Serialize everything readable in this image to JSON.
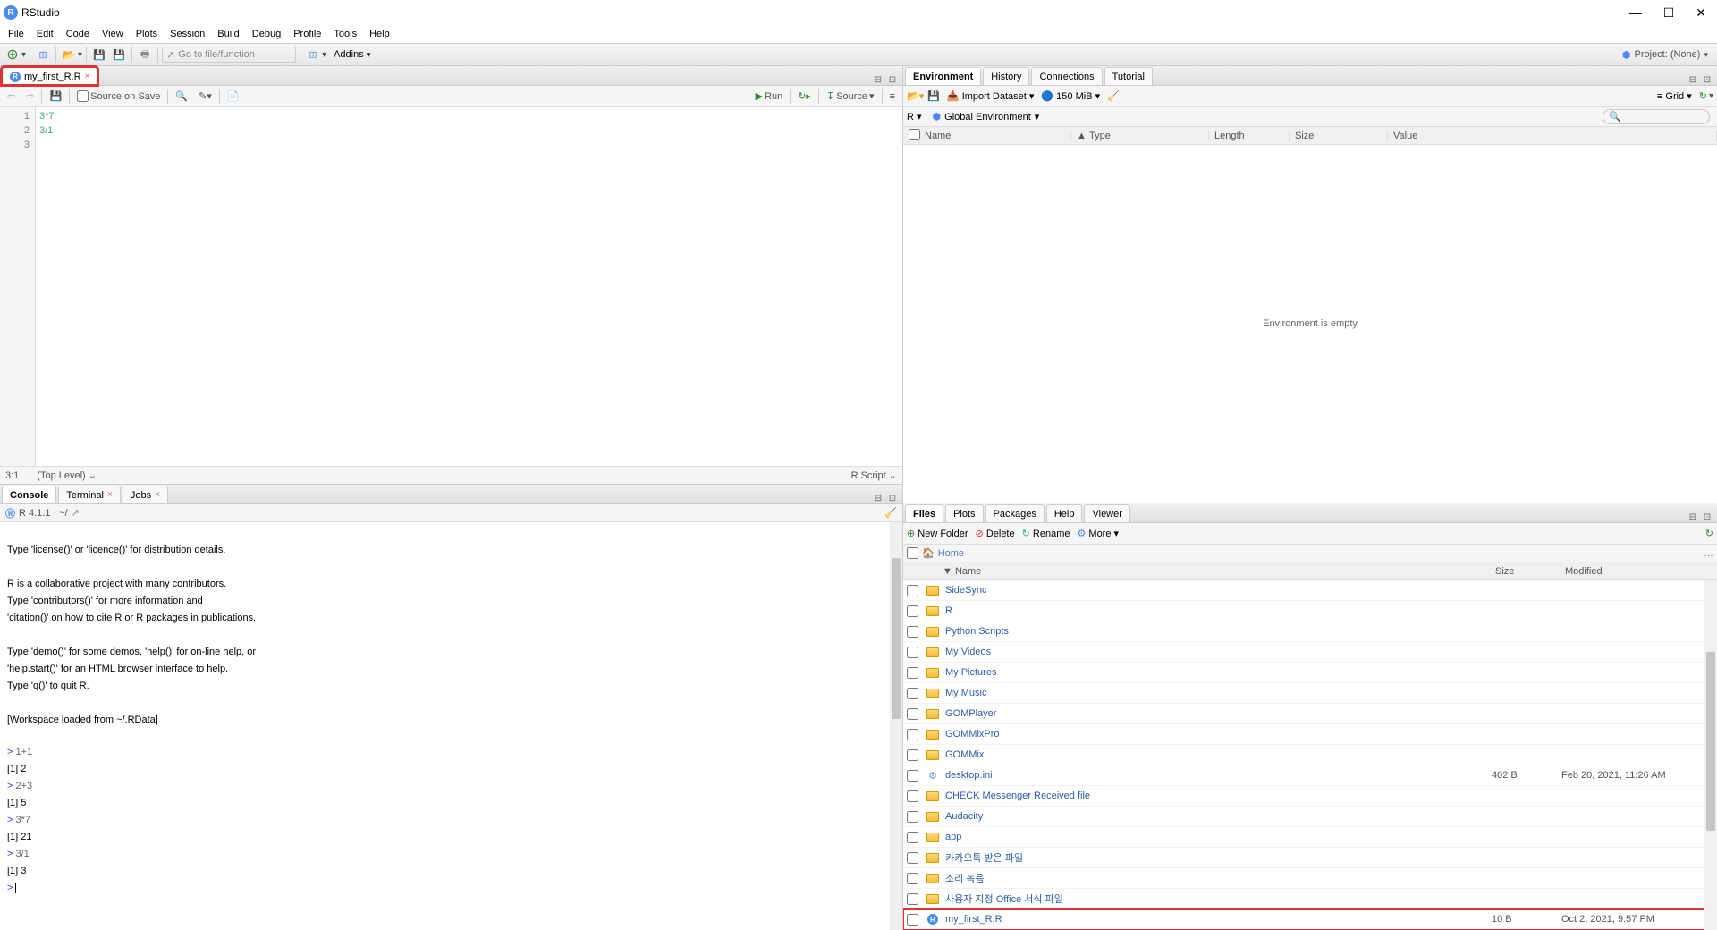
{
  "titlebar": {
    "app_name": "RStudio"
  },
  "menubar": {
    "items": [
      "File",
      "Edit",
      "Code",
      "View",
      "Plots",
      "Session",
      "Build",
      "Debug",
      "Profile",
      "Tools",
      "Help"
    ]
  },
  "toolbar": {
    "goto_placeholder": "Go to file/function",
    "addins": "Addins",
    "project": "Project: (None)"
  },
  "source": {
    "tab_name": "my_first_R.R",
    "source_on_save": "Source on Save",
    "run": "Run",
    "source_btn": "Source",
    "lines": [
      "3*7",
      "3/1",
      ""
    ],
    "status_pos": "3:1",
    "status_scope": "(Top Level)",
    "status_type": "R Script"
  },
  "console": {
    "tabs": [
      "Console",
      "Terminal",
      "Jobs"
    ],
    "version": "R 4.1.1 · ~/",
    "text": "Type 'license()' or 'licence()' for distribution details.\n\nR is a collaborative project with many contributors.\nType 'contributors()' for more information and\n'citation()' on how to cite R or R packages in publications.\n\nType 'demo()' for some demos, 'help()' for on-line help, or\n'help.start()' for an HTML browser interface to help.\nType 'q()' to quit R.\n\n[Workspace loaded from ~/.RData]\n",
    "history": [
      {
        "in": "1+1",
        "out": "[1] 2"
      },
      {
        "in": "2+3",
        "out": "[1] 5"
      },
      {
        "in": "3*7",
        "out": "[1] 21"
      },
      {
        "in": "3/1",
        "out": "[1] 3"
      }
    ]
  },
  "env": {
    "tabs": [
      "Environment",
      "History",
      "Connections",
      "Tutorial"
    ],
    "import": "Import Dataset",
    "mem": "150 MiB",
    "grid": "Grid",
    "scope_lang": "R",
    "scope": "Global Environment",
    "cols": {
      "name": "Name",
      "type": "Type",
      "length": "Length",
      "size": "Size",
      "value": "Value"
    },
    "empty": "Environment is empty"
  },
  "files": {
    "tabs": [
      "Files",
      "Plots",
      "Packages",
      "Help",
      "Viewer"
    ],
    "new_folder": "New Folder",
    "delete": "Delete",
    "rename": "Rename",
    "more": "More",
    "home": "Home",
    "cols": {
      "name": "Name",
      "size": "Size",
      "modified": "Modified"
    },
    "rows": [
      {
        "icon": "folder",
        "name": "SideSync",
        "size": "",
        "mod": ""
      },
      {
        "icon": "folder",
        "name": "R",
        "size": "",
        "mod": ""
      },
      {
        "icon": "folder",
        "name": "Python Scripts",
        "size": "",
        "mod": ""
      },
      {
        "icon": "folder",
        "name": "My Videos",
        "size": "",
        "mod": ""
      },
      {
        "icon": "folder",
        "name": "My Pictures",
        "size": "",
        "mod": ""
      },
      {
        "icon": "folder",
        "name": "My Music",
        "size": "",
        "mod": ""
      },
      {
        "icon": "folder",
        "name": "GOMPlayer",
        "size": "",
        "mod": ""
      },
      {
        "icon": "folder",
        "name": "GOMMixPro",
        "size": "",
        "mod": ""
      },
      {
        "icon": "folder",
        "name": "GOMMix",
        "size": "",
        "mod": ""
      },
      {
        "icon": "file",
        "name": "desktop.ini",
        "size": "402 B",
        "mod": "Feb 20, 2021, 11:26 AM"
      },
      {
        "icon": "folder",
        "name": "CHECK Messenger Received file",
        "size": "",
        "mod": ""
      },
      {
        "icon": "folder",
        "name": "Audacity",
        "size": "",
        "mod": ""
      },
      {
        "icon": "folder",
        "name": "app",
        "size": "",
        "mod": ""
      },
      {
        "icon": "folder",
        "name": "카카오톡 받은 파일",
        "size": "",
        "mod": ""
      },
      {
        "icon": "folder",
        "name": "소리 녹음",
        "size": "",
        "mod": ""
      },
      {
        "icon": "folder",
        "name": "사용자 지정 Office 서식 파일",
        "size": "",
        "mod": ""
      },
      {
        "icon": "r",
        "name": "my_first_R.R",
        "size": "10 B",
        "mod": "Oct 2, 2021, 9:57 PM",
        "hl": true
      }
    ]
  }
}
